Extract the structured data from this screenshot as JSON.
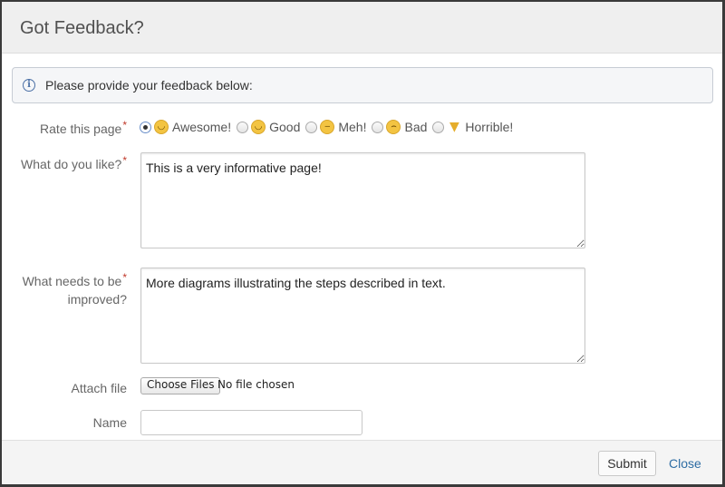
{
  "dialog": {
    "title": "Got Feedback?",
    "info": "Please provide your feedback below:"
  },
  "form": {
    "rating": {
      "label": "Rate this page",
      "required_marker": "*",
      "selected": "Awesome!",
      "options": [
        {
          "label": "Awesome!",
          "icon": "grinning-face-icon",
          "glyph": "◡",
          "checked": true
        },
        {
          "label": "Good",
          "icon": "smiling-face-icon",
          "glyph": "◡",
          "checked": false
        },
        {
          "label": "Meh!",
          "icon": "smirk-face-icon",
          "glyph": "‒",
          "checked": false
        },
        {
          "label": "Bad",
          "icon": "frowning-face-icon",
          "glyph": "⌢",
          "checked": false
        },
        {
          "label": "Horrible!",
          "icon": "thumbs-down-icon",
          "glyph": "👎",
          "checked": false
        }
      ]
    },
    "likes": {
      "label": "What do you like?",
      "required_marker": "*",
      "value": "This is a very informative page!"
    },
    "improve": {
      "label_line1": "What needs to be",
      "label_line2": "improved?",
      "required_marker": "*",
      "value": "More diagrams illustrating the steps described in text."
    },
    "attach": {
      "label": "Attach file",
      "button": "Choose Files",
      "status": "No file chosen"
    },
    "name": {
      "label": "Name",
      "value": ""
    }
  },
  "footer": {
    "submit": "Submit",
    "close": "Close"
  },
  "colors": {
    "link": "#2e6da4",
    "required": "#c0392b",
    "header_bg": "#efefef"
  }
}
